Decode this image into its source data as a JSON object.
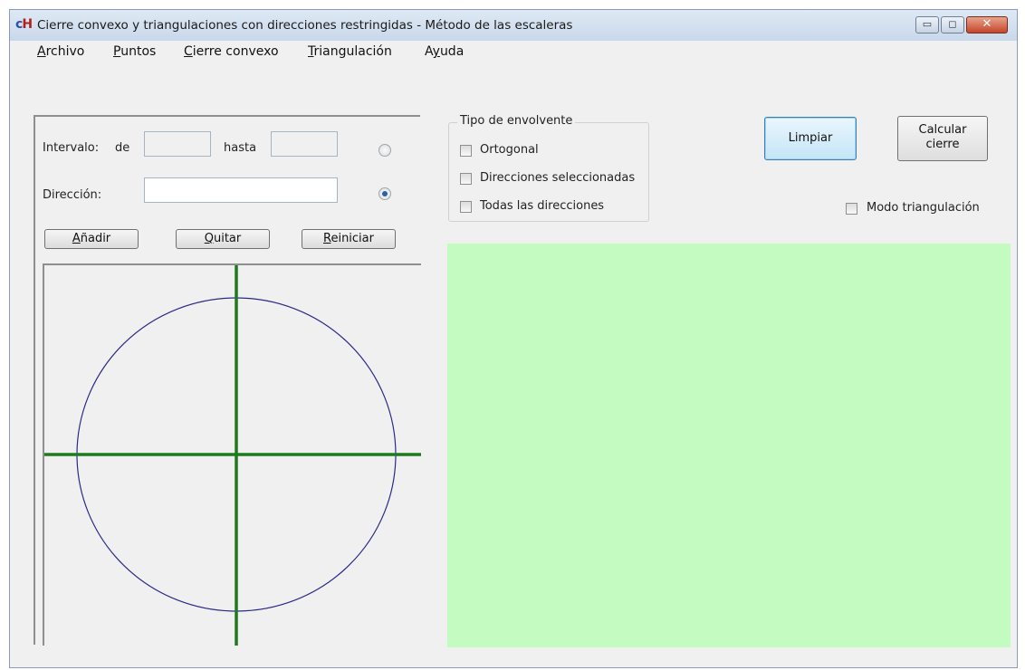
{
  "window": {
    "title": "Cierre convexo y triangulaciones con direcciones restringidas - Método de las escaleras",
    "icon_text_a": "c",
    "icon_text_b": "H",
    "buttons": {
      "minimize": "▭",
      "maximize": "◻",
      "close": "✕"
    }
  },
  "menu": {
    "items": [
      {
        "accel": "A",
        "rest": "rchivo"
      },
      {
        "accel": "P",
        "rest": "untos"
      },
      {
        "accel": "C",
        "rest": "ierre convexo"
      },
      {
        "accel": "T",
        "rest": "riangulación"
      },
      {
        "pre": "A",
        "accel": "y",
        "rest": "uda"
      }
    ]
  },
  "interval": {
    "label": "Intervalo:",
    "from_label": "de",
    "to_label": "hasta",
    "from_value": "",
    "to_value": "",
    "selected": false
  },
  "direction": {
    "label": "Dirección:",
    "value": "",
    "selected": true
  },
  "buttons": {
    "add": {
      "accel": "A",
      "rest": "ñadir"
    },
    "remove": {
      "accel": "Q",
      "rest": "uitar"
    },
    "reset": {
      "accel": "R",
      "rest": "einiciar"
    },
    "clear": "Limpiar",
    "calculate_line1": "Calcular",
    "calculate_line2": "cierre"
  },
  "envelope_group": {
    "title": "Tipo de envolvente",
    "options": [
      {
        "label": "Ortogonal",
        "checked": false
      },
      {
        "label": "Direcciones seleccionadas",
        "checked": false
      },
      {
        "label": "Todas las direcciones",
        "checked": false
      }
    ]
  },
  "triangulation_mode": {
    "label": "Modo triangulación",
    "checked": false
  },
  "colors": {
    "canvas_green": "#c3fbc0",
    "circle": "#2a2a8a",
    "axes": "#1f7a1f"
  }
}
